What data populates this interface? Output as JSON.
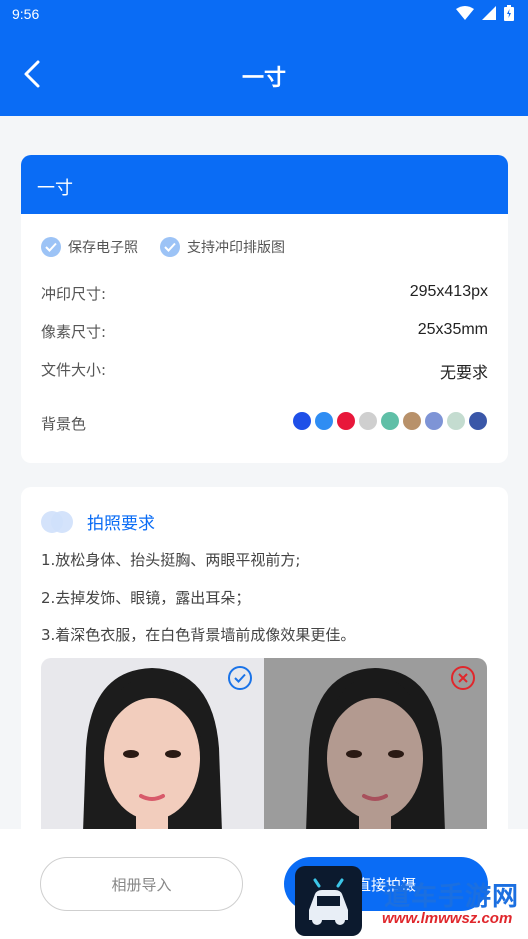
{
  "status_bar": {
    "time": "9:56"
  },
  "app_bar": {
    "title": "一寸"
  },
  "spec_card": {
    "header": "一寸",
    "features": [
      "保存电子照",
      "支持冲印排版图"
    ],
    "rows": [
      {
        "label": "冲印尺寸:",
        "value": "295x413px"
      },
      {
        "label": "像素尺寸:",
        "value": "25x35mm"
      },
      {
        "label": "文件大小:",
        "value": "无要求"
      }
    ],
    "background_label": "背景色",
    "background_colors": [
      "#1e4fe8",
      "#2f8df3",
      "#e8173a",
      "#cfcfcf",
      "#5fbfa7",
      "#b8916a",
      "#7e94d6",
      "#c4dcd0",
      "#3a57a8"
    ]
  },
  "requirements_card": {
    "title": "拍照要求",
    "lines": [
      "1.放松身体、抬头挺胸、两眼平视前方;",
      "2.去掉发饰、眼镜，露出耳朵；",
      "3.着深色衣服，在白色背景墙前成像效果更佳。"
    ],
    "examples": [
      {
        "kind": "correct",
        "badge_color": "#1a73e8"
      },
      {
        "kind": "incorrect",
        "badge_color": "#e0272c"
      }
    ]
  },
  "bottom_bar": {
    "album_label": "相册导入",
    "shoot_label": "直接拍摄"
  },
  "watermark": {
    "text": "道车手游网",
    "url": "www.lmwwsz.com"
  }
}
